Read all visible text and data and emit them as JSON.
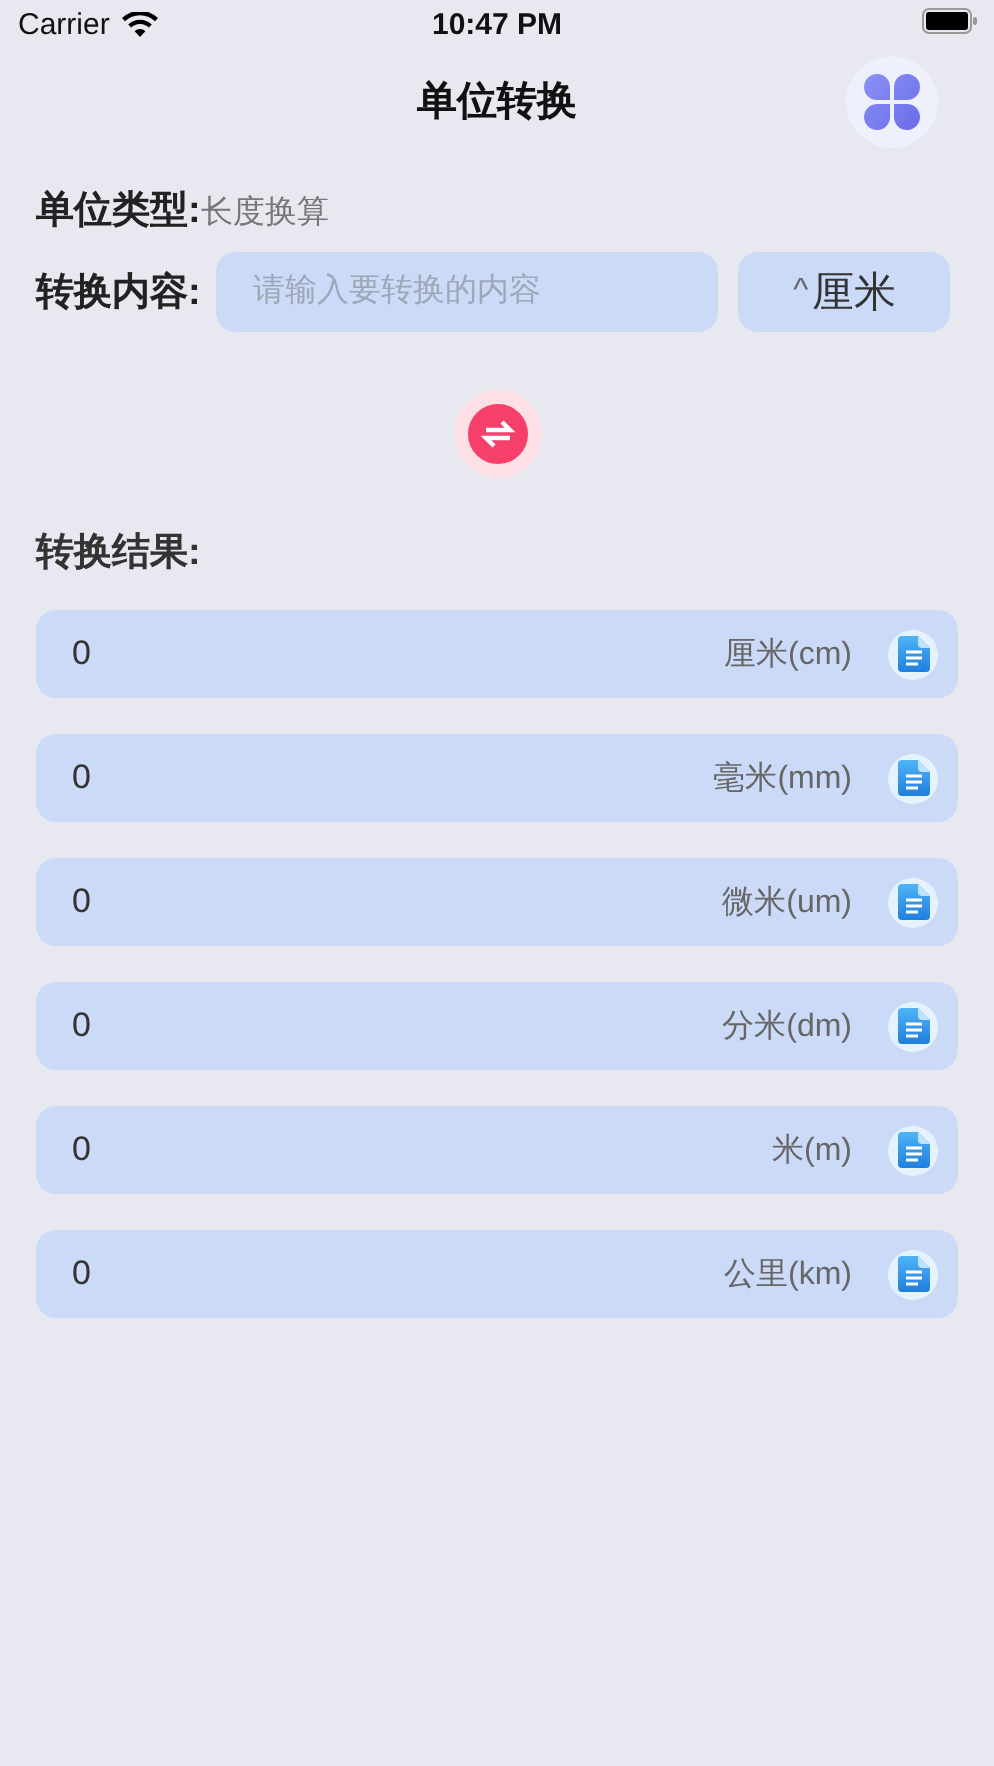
{
  "status_bar": {
    "carrier": "Carrier",
    "time": "10:47 PM"
  },
  "nav": {
    "title": "单位转换"
  },
  "unit_type": {
    "label": "单位类型:",
    "value": "长度换算"
  },
  "input_row": {
    "label": "转换内容:",
    "placeholder": "请输入要转换的内容",
    "unit_button": {
      "arrow": "^",
      "label": "厘米"
    }
  },
  "results_title": "转换结果:",
  "results": [
    {
      "value": "0",
      "unit": "厘米(cm)"
    },
    {
      "value": "0",
      "unit": "毫米(mm)"
    },
    {
      "value": "0",
      "unit": "微米(um)"
    },
    {
      "value": "0",
      "unit": "分米(dm)"
    },
    {
      "value": "0",
      "unit": "米(m)"
    },
    {
      "value": "0",
      "unit": "公里(km)"
    }
  ]
}
